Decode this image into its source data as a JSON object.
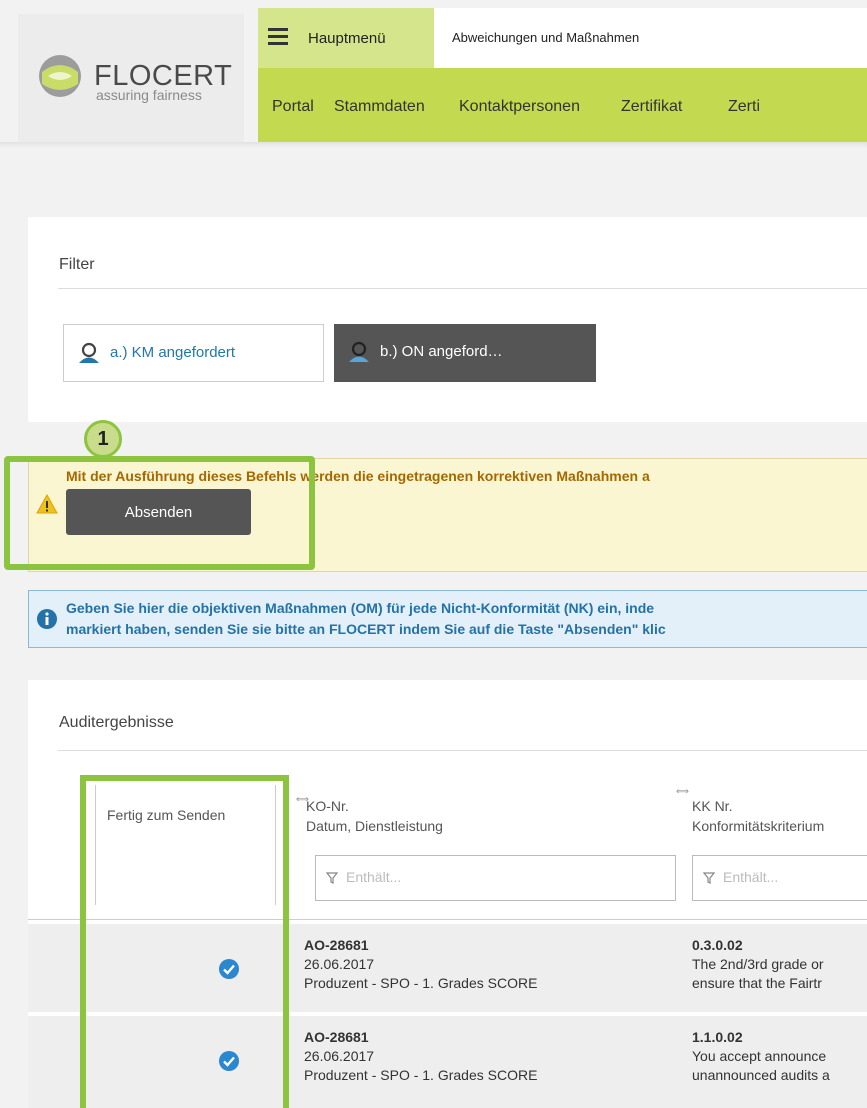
{
  "logo": {
    "name": "FLOCERT",
    "tagline": "assuring fairness",
    "colors": {
      "mark": "#c9dc67",
      "mark_dark": "#9c9c9c"
    }
  },
  "header": {
    "menu_label": "Hauptmenü",
    "page_title": "Abweichungen und Maßnahmen",
    "nav": [
      "Portal",
      "Stammdaten",
      "Kontaktpersonen",
      "Zertifikat",
      "Zerti"
    ]
  },
  "filter": {
    "title": "Filter",
    "buttons": [
      {
        "label": "a.) KM angefordert",
        "icon": "user-icon"
      },
      {
        "label": "b.) ON angeford…",
        "icon": "user-icon"
      }
    ]
  },
  "callouts": {
    "badge": "1"
  },
  "warning": {
    "text": "Mit der Ausführung dieses Befehls werden die eingetragenen korrektiven Maßnahmen a",
    "button": "Absenden",
    "icon": "warning-icon"
  },
  "info": {
    "line1": "Geben Sie hier die objektiven Maßnahmen (OM) für jede Nicht-Konformität (NK) ein, inde",
    "line2": "markiert haben, senden Sie sie bitte an FLOCERT indem Sie auf die Taste \"Absenden\" klic",
    "icon": "info-icon"
  },
  "results": {
    "title": "Auditergebnisse",
    "columns": [
      {
        "line1": "Fertig zum Senden",
        "line2": ""
      },
      {
        "line1": "KO-Nr.",
        "line2": "Datum, Dienstleistung"
      },
      {
        "line1": "KK Nr.",
        "line2": "Konformitätskriterium"
      }
    ],
    "filter_placeholder": "Enthält...",
    "rows": [
      {
        "ready": true,
        "ko_nr": "AO-28681",
        "date": "26.06.2017",
        "service": "Produzent - SPO - 1. Grades SCORE",
        "kk_nr": "0.3.0.02",
        "criterion_1": "The 2nd/3rd grade or",
        "criterion_2": "ensure that the Fairtr"
      },
      {
        "ready": true,
        "ko_nr": "AO-28681",
        "date": "26.06.2017",
        "service": "Produzent - SPO - 1. Grades SCORE",
        "kk_nr": "1.1.0.02",
        "criterion_1": "You accept announce",
        "criterion_2": "unannounced audits a"
      }
    ]
  },
  "colors": {
    "nav_green": "#c3d94f",
    "menu_green": "#d5e58c",
    "highlight_green": "#8cc43f",
    "warning_text": "#a56800",
    "info_text": "#2372a8",
    "check_blue": "#2a87d0"
  }
}
